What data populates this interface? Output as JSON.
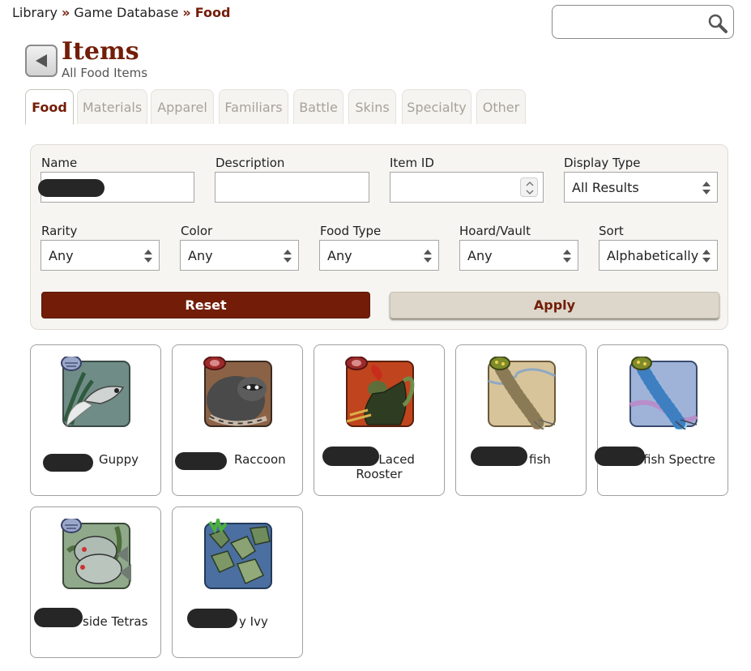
{
  "breadcrumb": {
    "items": [
      "Library",
      "Game Database"
    ],
    "separator": "»",
    "current": "Food"
  },
  "search": {
    "placeholder": "",
    "value": ""
  },
  "header": {
    "title": "Items",
    "subtitle": "All Food Items"
  },
  "tabs": [
    {
      "label": "Food",
      "active": true
    },
    {
      "label": "Materials",
      "active": false
    },
    {
      "label": "Apparel",
      "active": false
    },
    {
      "label": "Familiars",
      "active": false
    },
    {
      "label": "Battle",
      "active": false
    },
    {
      "label": "Skins",
      "active": false
    },
    {
      "label": "Specialty",
      "active": false
    },
    {
      "label": "Other",
      "active": false
    }
  ],
  "filters": {
    "name": {
      "label": "Name",
      "value": ""
    },
    "description": {
      "label": "Description",
      "value": ""
    },
    "item_id": {
      "label": "Item ID",
      "value": ""
    },
    "display_type": {
      "label": "Display Type",
      "value": "All Results"
    },
    "rarity": {
      "label": "Rarity",
      "value": "Any"
    },
    "color": {
      "label": "Color",
      "value": "Any"
    },
    "food_type": {
      "label": "Food Type",
      "value": "Any"
    },
    "hoard_vault": {
      "label": "Hoard/Vault",
      "value": "Any"
    },
    "sort": {
      "label": "Sort",
      "value": "Alphabetically"
    },
    "reset_label": "Reset",
    "apply_label": "Apply"
  },
  "items": [
    {
      "name": "Guppy",
      "badge": "seafood-icon",
      "art": "fish-icon"
    },
    {
      "name": "Raccoon",
      "badge": "meat-icon",
      "art": "raccoon-icon"
    },
    {
      "name": "-Laced",
      "name2": "Rooster",
      "badge": "meat-icon",
      "art": "rooster-icon"
    },
    {
      "name": "fish",
      "badge": "insect-icon",
      "art": "silverfish-icon"
    },
    {
      "name": "fish Spectre",
      "badge": "insect-icon",
      "art": "silverfish-spectre-icon"
    },
    {
      "name": "side Tetras",
      "badge": "seafood-icon",
      "art": "tetra-icon"
    },
    {
      "name": "y Ivy",
      "badge": "plant-icon",
      "art": "ivy-icon"
    }
  ],
  "colors": {
    "brand": "#731d08",
    "panel": "#f6f5f2",
    "apply_bg": "#dcd7ca"
  }
}
